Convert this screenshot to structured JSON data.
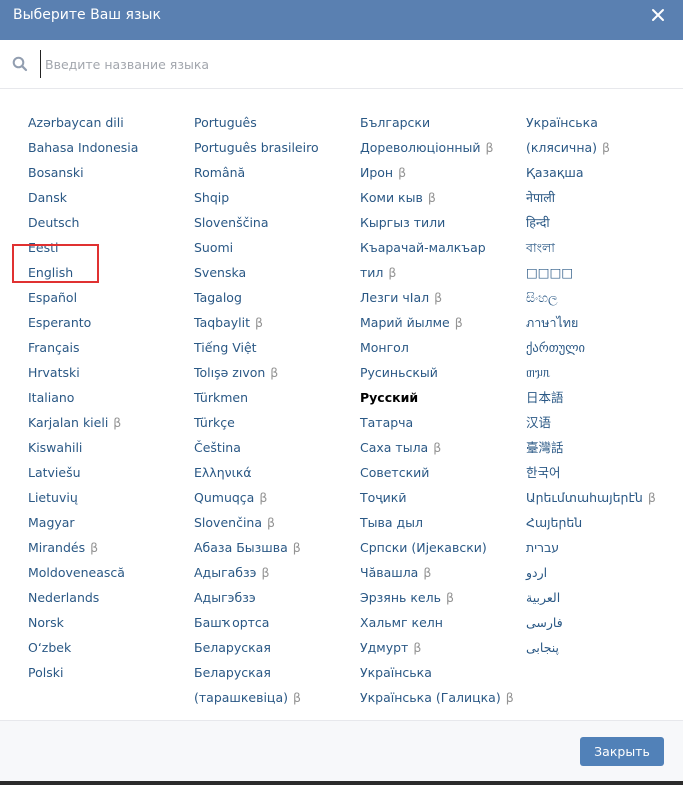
{
  "modal": {
    "title": "Выберите Ваш язык",
    "close_button_label": "Закрыть"
  },
  "search": {
    "placeholder": "Введите название языка",
    "value": ""
  },
  "beta_mark": "β",
  "columns": [
    [
      {
        "label": "Azərbaycan dili"
      },
      {
        "label": "Bahasa Indonesia"
      },
      {
        "label": "Bosanski"
      },
      {
        "label": "Dansk"
      },
      {
        "label": "Deutsch"
      },
      {
        "label": "Eesti"
      },
      {
        "label": "English"
      },
      {
        "label": "Español"
      },
      {
        "label": "Esperanto"
      },
      {
        "label": "Français"
      },
      {
        "label": "Hrvatski"
      },
      {
        "label": "Italiano"
      },
      {
        "label": "Karjalan kieli",
        "beta": true
      },
      {
        "label": "Kiswahili"
      },
      {
        "label": "Latviešu"
      },
      {
        "label": "Lietuvių"
      },
      {
        "label": "Magyar"
      },
      {
        "label": "Mirandés",
        "beta": true
      },
      {
        "label": "Moldovenească"
      },
      {
        "label": "Nederlands"
      },
      {
        "label": "Norsk"
      },
      {
        "label": "O‘zbek"
      },
      {
        "label": "Polski"
      }
    ],
    [
      {
        "label": "Português"
      },
      {
        "label": "Português brasileiro"
      },
      {
        "label": "Română"
      },
      {
        "label": "Shqip"
      },
      {
        "label": "Slovenščina"
      },
      {
        "label": "Suomi"
      },
      {
        "label": "Svenska"
      },
      {
        "label": "Tagalog"
      },
      {
        "label": "Taqbaylit",
        "beta": true
      },
      {
        "label": "Tiếng Việt"
      },
      {
        "label": "Tolışə zıvon",
        "beta": true
      },
      {
        "label": "Türkmen"
      },
      {
        "label": "Türkçe"
      },
      {
        "label": "Čeština"
      },
      {
        "label": "Ελληνικά"
      },
      {
        "label": "Qumuqça",
        "beta": true
      },
      {
        "label": "Slovenčina",
        "beta": true
      },
      {
        "label": "Абаза Бызшва",
        "beta": true
      },
      {
        "label": "Адыгабзэ",
        "beta": true
      },
      {
        "label": "Адыгэбзэ"
      },
      {
        "label": "Башҡортса"
      },
      {
        "label": "Беларуская"
      },
      {
        "label": "Беларуская (тарашкевіца)",
        "beta": true,
        "wrap": true
      }
    ],
    [
      {
        "label": "Български"
      },
      {
        "label": "Дореволюціонный",
        "beta": true
      },
      {
        "label": "Ирон",
        "beta": true
      },
      {
        "label": "Коми кыв",
        "beta": true
      },
      {
        "label": "Кыргыз тили"
      },
      {
        "label": "Къарачай-малкъар тил",
        "beta": true,
        "wrap": true
      },
      {
        "label": "Лезги чӀал",
        "beta": true
      },
      {
        "label": "Марий йылме",
        "beta": true
      },
      {
        "label": "Монгол"
      },
      {
        "label": "Русиньскый"
      },
      {
        "label": "Русский",
        "current": true
      },
      {
        "label": "Татарча"
      },
      {
        "label": "Саха тыла",
        "beta": true
      },
      {
        "label": "Советский"
      },
      {
        "label": "Тоҷикӣ"
      },
      {
        "label": "Тыва дыл"
      },
      {
        "label": "Српски (Ијекавски)"
      },
      {
        "label": "Чӑвашла",
        "beta": true
      },
      {
        "label": "Эрзянь кель",
        "beta": true
      },
      {
        "label": "Хальмг келн"
      },
      {
        "label": "Удмурт",
        "beta": true
      },
      {
        "label": "Українська"
      },
      {
        "label": "Українська (Галицка)",
        "beta": true
      }
    ],
    [
      {
        "label": "Українська (клясична)",
        "beta": true,
        "wrap": true
      },
      {
        "label": "Қазақша"
      },
      {
        "label": "नेपाली"
      },
      {
        "label": "हिन्दी"
      },
      {
        "label": "বাংলা"
      },
      {
        "label": "□□□□"
      },
      {
        "label": "සිංහල"
      },
      {
        "label": "ภาษาไทย"
      },
      {
        "label": "ქართული"
      },
      {
        "label": "ᥖᥭᥰ"
      },
      {
        "label": "日本語"
      },
      {
        "label": "汉语"
      },
      {
        "label": "臺灣話"
      },
      {
        "label": "한국어"
      },
      {
        "label": "Արեւմտահայերէն",
        "beta": true
      },
      {
        "label": "Հայերեն"
      },
      {
        "label": "עברית"
      },
      {
        "label": "اردو"
      },
      {
        "label": "العربية"
      },
      {
        "label": "فارسی"
      },
      {
        "label": "پنجابی"
      }
    ]
  ],
  "colors": {
    "header_bg": "#5a80b1",
    "link": "#2a5885",
    "button_bg": "#5181b8",
    "highlight": "#e03131"
  }
}
